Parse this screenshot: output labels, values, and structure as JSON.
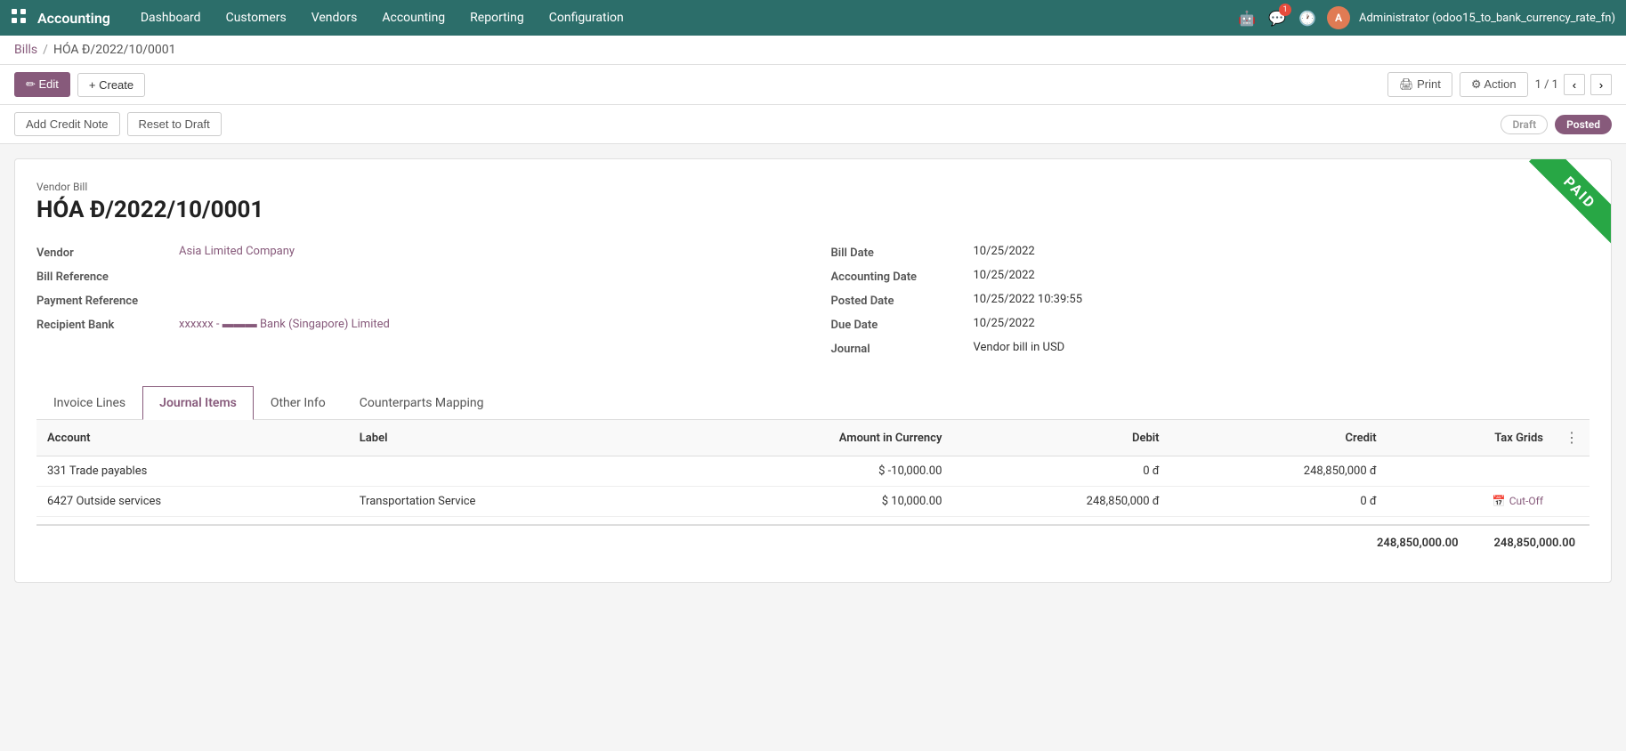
{
  "topnav": {
    "brand": "Accounting",
    "menu_items": [
      "Dashboard",
      "Customers",
      "Vendors",
      "Accounting",
      "Reporting",
      "Configuration"
    ],
    "user": "Administrator (odoo15_to_bank_currency_rate_fn)",
    "user_initial": "A",
    "notif_count": "1"
  },
  "breadcrumb": {
    "parent": "Bills",
    "separator": "/",
    "current": "HÓA Đ/2022/10/0001"
  },
  "toolbar": {
    "edit_label": "✏ Edit",
    "create_label": "+ Create",
    "print_label": "🖨 Print",
    "action_label": "⚙ Action",
    "pagination": "1 / 1",
    "add_credit_note_label": "Add Credit Note",
    "reset_to_draft_label": "Reset to Draft",
    "status_draft": "Draft",
    "status_posted": "Posted"
  },
  "form": {
    "label": "Vendor Bill",
    "title": "HÓA Đ/2022/10/0001",
    "paid_ribbon": "PAID",
    "fields_left": {
      "vendor_label": "Vendor",
      "vendor_value": "Asia Limited Company",
      "bill_ref_label": "Bill Reference",
      "bill_ref_value": "",
      "payment_ref_label": "Payment Reference",
      "payment_ref_value": "",
      "recipient_bank_label": "Recipient Bank",
      "recipient_bank_value": "xxxxxx - ▬▬▬ Bank (Singapore) Limited"
    },
    "fields_right": {
      "bill_date_label": "Bill Date",
      "bill_date_value": "10/25/2022",
      "accounting_date_label": "Accounting Date",
      "accounting_date_value": "10/25/2022",
      "posted_date_label": "Posted Date",
      "posted_date_value": "10/25/2022 10:39:55",
      "due_date_label": "Due Date",
      "due_date_value": "10/25/2022",
      "journal_label": "Journal",
      "journal_value": "Vendor bill  in  USD"
    }
  },
  "tabs": [
    {
      "id": "invoice-lines",
      "label": "Invoice Lines",
      "active": false
    },
    {
      "id": "journal-items",
      "label": "Journal Items",
      "active": true
    },
    {
      "id": "other-info",
      "label": "Other Info",
      "active": false
    },
    {
      "id": "counterparts-mapping",
      "label": "Counterparts Mapping",
      "active": false
    }
  ],
  "table": {
    "columns": [
      {
        "key": "account",
        "label": "Account",
        "align": "left"
      },
      {
        "key": "label",
        "label": "Label",
        "align": "left"
      },
      {
        "key": "amount_currency",
        "label": "Amount in Currency",
        "align": "right"
      },
      {
        "key": "debit",
        "label": "Debit",
        "align": "right"
      },
      {
        "key": "credit",
        "label": "Credit",
        "align": "right"
      },
      {
        "key": "tax_grids",
        "label": "Tax Grids",
        "align": "right"
      }
    ],
    "rows": [
      {
        "account": "331 Trade payables",
        "label": "",
        "amount_currency": "$ -10,000.00",
        "debit": "0 đ",
        "credit": "248,850,000 đ",
        "tax_grids": "",
        "cutoff": false
      },
      {
        "account": "6427 Outside services",
        "label": "Transportation Service",
        "amount_currency": "$ 10,000.00",
        "debit": "248,850,000 đ",
        "credit": "0 đ",
        "tax_grids": "",
        "cutoff": true
      }
    ],
    "footer": {
      "debit_total": "248,850,000.00",
      "credit_total": "248,850,000.00"
    }
  }
}
